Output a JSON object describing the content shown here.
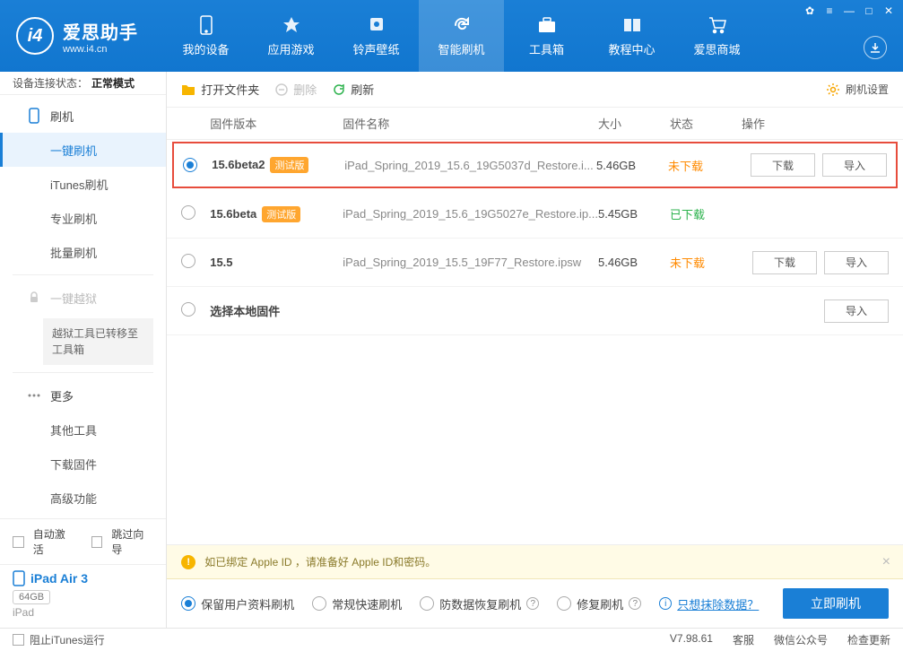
{
  "logo": {
    "title": "爱思助手",
    "sub": "www.i4.cn",
    "mark": "i4"
  },
  "nav": [
    {
      "label": "我的设备"
    },
    {
      "label": "应用游戏"
    },
    {
      "label": "铃声壁纸"
    },
    {
      "label": "智能刷机"
    },
    {
      "label": "工具箱"
    },
    {
      "label": "教程中心"
    },
    {
      "label": "爱思商城"
    }
  ],
  "conn_status": {
    "label": "设备连接状态：",
    "value": "正常模式"
  },
  "sidebar": {
    "flash": "刷机",
    "items": [
      "一键刷机",
      "iTunes刷机",
      "专业刷机",
      "批量刷机"
    ],
    "jailbreak": "一键越狱",
    "jailbreak_note": "越狱工具已转移至工具箱",
    "more": "更多",
    "more_items": [
      "其他工具",
      "下载固件",
      "高级功能"
    ],
    "auto_activate": "自动激活",
    "skip_guide": "跳过向导",
    "device_name": "iPad Air 3",
    "device_storage": "64GB",
    "device_type": "iPad"
  },
  "toolbar": {
    "open": "打开文件夹",
    "delete": "删除",
    "refresh": "刷新",
    "settings": "刷机设置"
  },
  "table": {
    "headers": {
      "ver": "固件版本",
      "name": "固件名称",
      "size": "大小",
      "status": "状态",
      "action": "操作"
    },
    "download": "下载",
    "import": "导入",
    "rows": [
      {
        "selected": true,
        "highlight": true,
        "ver": "15.6beta2",
        "tag": "测试版",
        "name": "iPad_Spring_2019_15.6_19G5037d_Restore.i...",
        "size": "5.46GB",
        "status": "未下载",
        "status_cls": "nd",
        "actions": true
      },
      {
        "selected": false,
        "ver": "15.6beta",
        "tag": "测试版",
        "name": "iPad_Spring_2019_15.6_19G5027e_Restore.ip...",
        "size": "5.45GB",
        "status": "已下载",
        "status_cls": "dl",
        "actions": false
      },
      {
        "selected": false,
        "ver": "15.5",
        "tag": "",
        "name": "iPad_Spring_2019_15.5_19F77_Restore.ipsw",
        "size": "5.46GB",
        "status": "未下载",
        "status_cls": "nd",
        "actions": true
      },
      {
        "selected": false,
        "ver": "选择本地固件",
        "tag": "",
        "name": "",
        "size": "",
        "status": "",
        "status_cls": "",
        "actions": "import_only"
      }
    ]
  },
  "alert": "如已绑定 Apple ID ，请准备好 Apple ID和密码。",
  "flash_opts": [
    "保留用户资料刷机",
    "常规快速刷机",
    "防数据恢复刷机",
    "修复刷机"
  ],
  "erase_link": "只想抹除数据？",
  "flash_btn": "立即刷机",
  "footer": {
    "block_itunes": "阻止iTunes运行",
    "version": "V7.98.61",
    "links": [
      "客服",
      "微信公众号",
      "检查更新"
    ]
  }
}
